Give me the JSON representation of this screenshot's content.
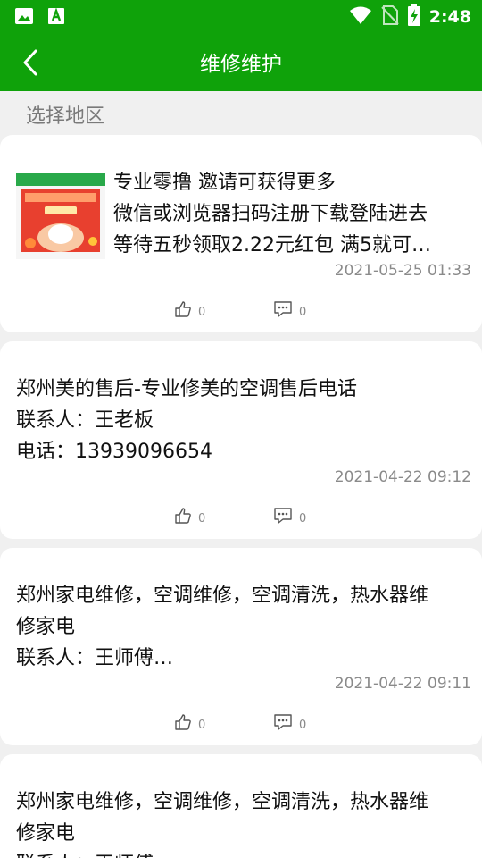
{
  "status_bar": {
    "time": "2:48",
    "icons": [
      "image-icon",
      "app-a-icon",
      "wifi-icon",
      "no-sim-icon",
      "battery-charging-icon"
    ]
  },
  "header": {
    "title": "维修维护",
    "back_icon": "chevron-left-icon"
  },
  "region_label": "选择地区",
  "colors": {
    "brand_green": "#0fa20a",
    "card_bg": "#ffffff",
    "page_bg": "#f0f0f0",
    "date_gray": "#8a8a8a"
  },
  "posts": [
    {
      "lines": [
        "专业零撸 邀请可获得更多",
        "微信或浏览器扫码注册下载登陆进去",
        "等待五秒领取2.22元红包 满5就可…"
      ],
      "date": "2021-05-25 01:33",
      "likes": "0",
      "comments": "0",
      "has_thumbnail": true
    },
    {
      "lines": [
        "郑州美的售后-专业修美的空调售后电话",
        "联系人：王老板",
        "电话：13939096654"
      ],
      "date": "2021-04-22 09:12",
      "likes": "0",
      "comments": "0",
      "has_thumbnail": false
    },
    {
      "lines": [
        "郑州家电维修，空调维修，空调清洗，热水器维",
        "修家电",
        "联系人：王师傅…"
      ],
      "date": "2021-04-22 09:11",
      "likes": "0",
      "comments": "0",
      "has_thumbnail": false
    },
    {
      "lines": [
        "郑州家电维修，空调维修，空调清洗，热水器维",
        "修家电",
        "联系人：王师傅…"
      ],
      "has_thumbnail": false
    }
  ]
}
